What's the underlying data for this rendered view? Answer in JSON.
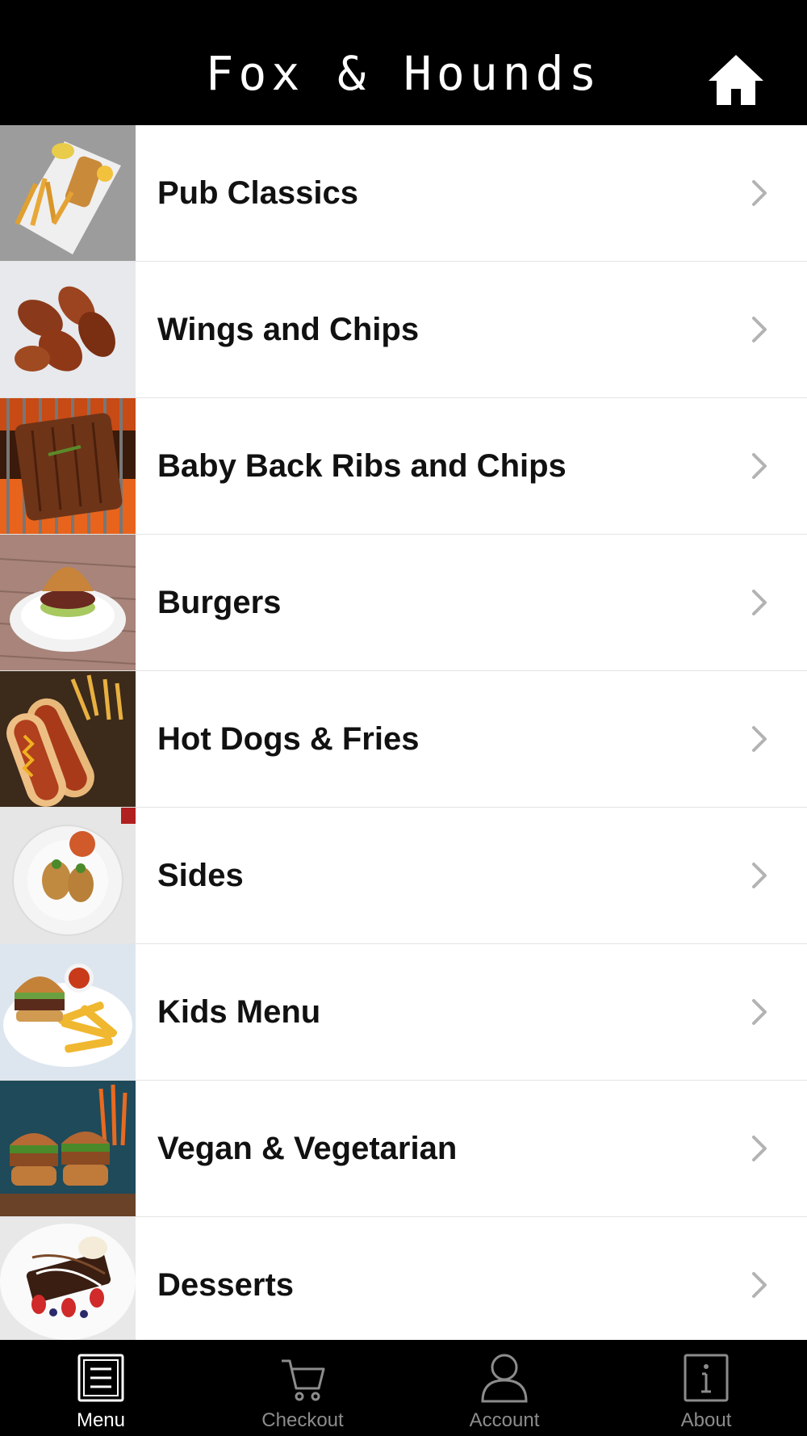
{
  "header": {
    "title": "Fox & Hounds",
    "home_icon": "home-icon"
  },
  "menu": {
    "items": [
      {
        "label": "Pub Classics",
        "image": "fish-and-chips-photo"
      },
      {
        "label": "Wings and Chips",
        "image": "chicken-wings-photo"
      },
      {
        "label": "Baby Back Ribs and Chips",
        "image": "ribs-on-grill-photo"
      },
      {
        "label": "Burgers",
        "image": "burger-photo"
      },
      {
        "label": "Hot Dogs & Fries",
        "image": "hot-dogs-photo"
      },
      {
        "label": "Sides",
        "image": "sides-photo"
      },
      {
        "label": "Kids Menu",
        "image": "kids-burger-and-chips-photo"
      },
      {
        "label": "Vegan & Vegetarian",
        "image": "vegan-burgers-photo"
      },
      {
        "label": "Desserts",
        "image": "dessert-photo"
      }
    ]
  },
  "tabbar": {
    "tabs": [
      {
        "label": "Menu",
        "icon": "menu-icon",
        "active": true
      },
      {
        "label": "Checkout",
        "icon": "cart-icon",
        "active": false
      },
      {
        "label": "Account",
        "icon": "person-icon",
        "active": false
      },
      {
        "label": "About",
        "icon": "info-icon",
        "active": false
      }
    ]
  },
  "colors": {
    "header_bg": "#000000",
    "tabbar_bg": "#000000",
    "active_tab": "#ffffff",
    "inactive_tab": "#8c8c8c",
    "divider": "#e4e4e4",
    "chevron": "#b3b3b3"
  }
}
